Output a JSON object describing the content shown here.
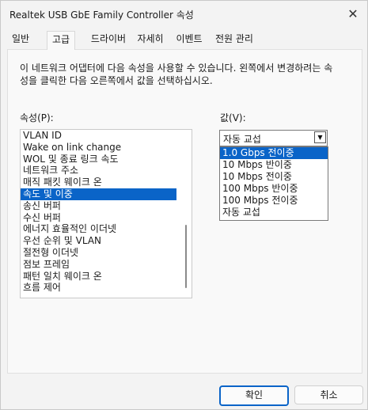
{
  "window": {
    "title": "Realtek USB GbE Family Controller 속성",
    "close_icon": "close-icon"
  },
  "tabs": [
    {
      "label": "일반"
    },
    {
      "label": "고급",
      "active": true
    },
    {
      "label": "드라이버"
    },
    {
      "label": "자세히"
    },
    {
      "label": "이벤트"
    },
    {
      "label": "전원 관리"
    }
  ],
  "panel": {
    "description": "이 네트워크 어댑터에 다음 속성을 사용할 수 있습니다. 왼쪽에서 변경하려는 속성을 클릭한 다음 오른쪽에서 값을 선택하십시오.",
    "property_label": "속성(P):",
    "value_label": "값(V):"
  },
  "properties": [
    "VLAN ID",
    "Wake on link change",
    "WOL 및 종료 링크 속도",
    "네트워크 주소",
    "매직 패킷 웨이크 온",
    "속도 및 이중",
    "송신 버퍼",
    "수신 버퍼",
    "에너지 효율적인 이더넷",
    "우선 순위 및 VLAN",
    "절전형 이더넷",
    "점보 프레임",
    "패턴 일치 웨이크 온",
    "흐름 제어"
  ],
  "selected_property": "속도 및 이중",
  "value": {
    "current": "자동 교섭",
    "options": [
      "1.0 Gbps 전이중",
      "10 Mbps 반이중",
      "10 Mbps 전이중",
      "100 Mbps 반이중",
      "100 Mbps 전이중",
      "자동 교섭"
    ],
    "highlighted": "1.0 Gbps 전이중"
  },
  "buttons": {
    "ok": "확인",
    "cancel": "취소"
  },
  "colors": {
    "selection": "#0a64c8",
    "window_bg": "#f3f3f3"
  }
}
